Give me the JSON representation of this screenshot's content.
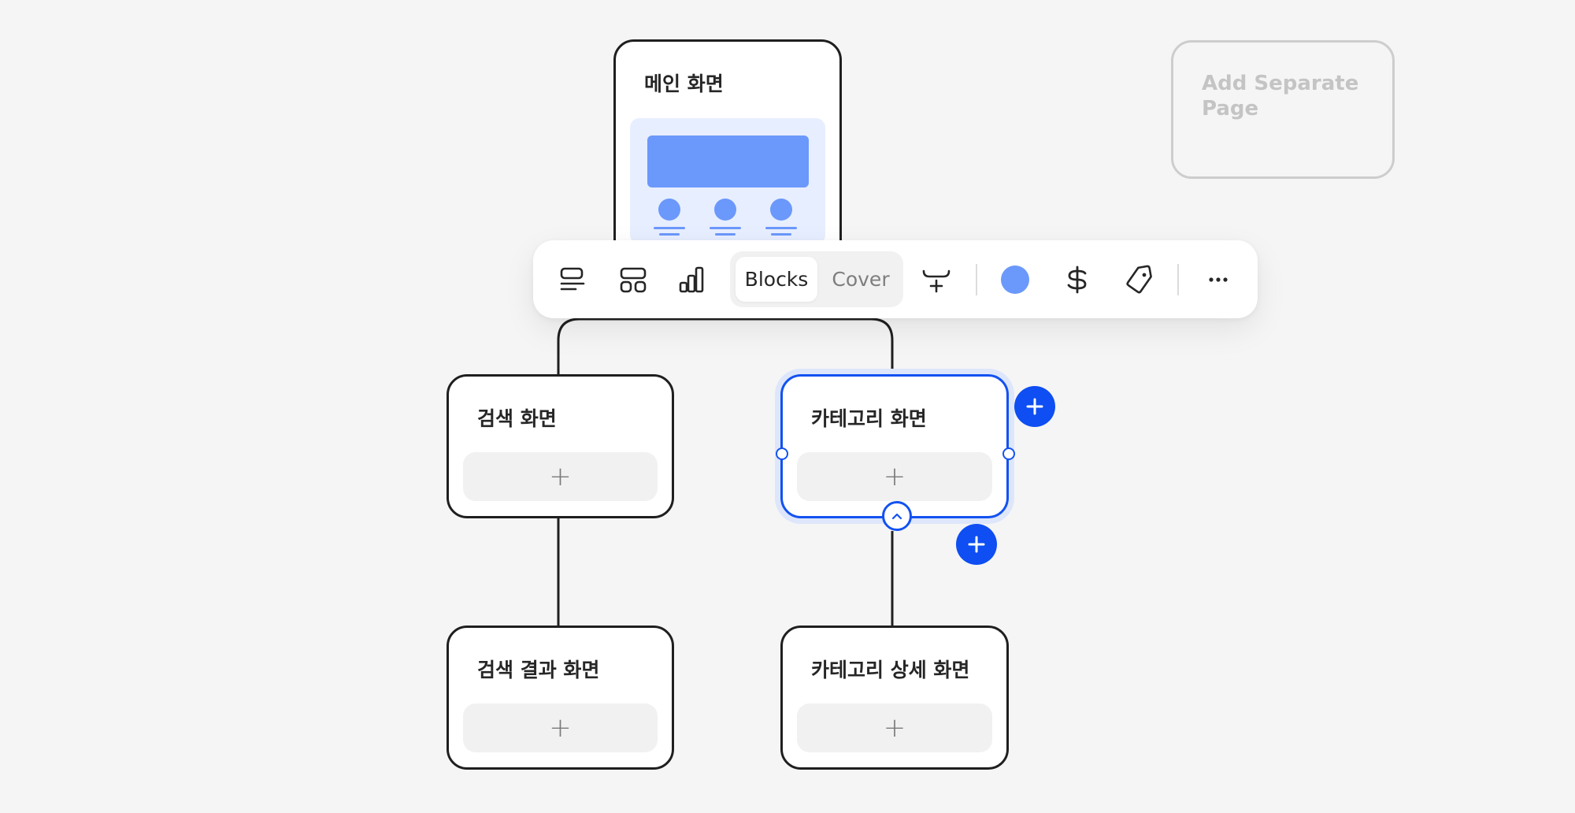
{
  "nodes": {
    "main": {
      "title": "메인 화면"
    },
    "search": {
      "title": "검색 화면",
      "add_symbol": "+"
    },
    "category": {
      "title": "카테고리 화면",
      "add_symbol": "+"
    },
    "search_result": {
      "title": "검색 결과 화면",
      "add_symbol": "+"
    },
    "category_detail": {
      "title": "카테고리 상세 화면",
      "add_symbol": "+"
    }
  },
  "separate_page": {
    "label": "Add Separate Page"
  },
  "toolbar": {
    "segmented": {
      "blocks_label": "Blocks",
      "cover_label": "Cover",
      "selected": "Blocks"
    },
    "color_swatch": "#6b98fb",
    "icons": [
      "text-layout-icon",
      "grid-layout-icon",
      "bar-chart-icon",
      "insert-between-icon",
      "dollar-icon",
      "tag-icon",
      "more-icon"
    ]
  },
  "colors": {
    "accent": "#0e4ef2",
    "preview": "#6b98fb",
    "preview_bg": "#e7eeff",
    "canvas": "#f5f5f5",
    "border": "#1f1f1f"
  }
}
